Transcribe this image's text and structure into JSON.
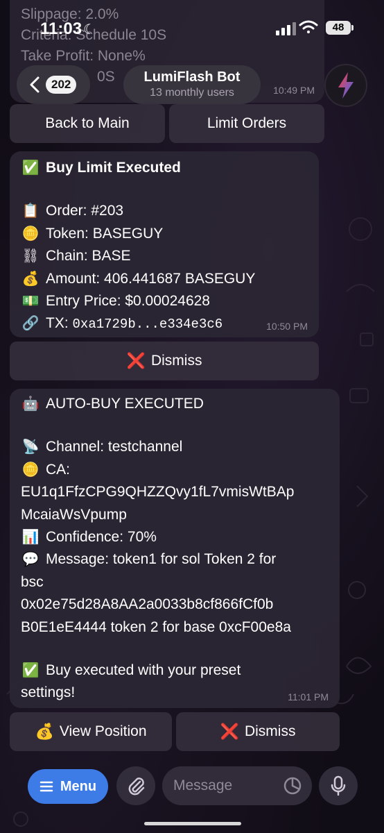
{
  "status_bar": {
    "time": "11:03",
    "battery": "48"
  },
  "previous_message": {
    "lines": [
      "Slippage: 2.0%",
      "Criteria: Schedule 10S",
      "Take Profit: None%",
      "0S"
    ],
    "time": "10:49 PM"
  },
  "header": {
    "back_count": "202",
    "title": "LumiFlash Bot",
    "subtitle": "13 monthly users"
  },
  "keyboard_top": {
    "back_to_main": "Back to Main",
    "limit_orders": "Limit Orders"
  },
  "limit_message": {
    "title_emoji": "✅",
    "title": "Buy Limit Executed",
    "rows": [
      {
        "emoji": "📋",
        "label": "Order: #203"
      },
      {
        "emoji": "🪙",
        "label": "Token: BASEGUY"
      },
      {
        "emoji": "⛓",
        "label": "Chain: BASE"
      },
      {
        "emoji": "💰",
        "label": "Amount: 406.441687 BASEGUY"
      },
      {
        "emoji": "💵",
        "label": "Entry Price: $0.00024628"
      }
    ],
    "tx_emoji": "🔗",
    "tx_label": "TX: ",
    "tx_value": "0xa1729b...e334e3c6",
    "time": "10:50 PM"
  },
  "dismiss_1": {
    "emoji": "❌",
    "label": "Dismiss"
  },
  "autobuy_message": {
    "title_emoji": "🤖",
    "title": "AUTO-BUY EXECUTED",
    "channel_emoji": "📡",
    "channel": "Channel: testchannel",
    "ca_emoji": "🪙",
    "ca_label": "CA:",
    "ca_line1": "EU1q1FfzCPG9QHZZQvy1fL7vmisWtBAp",
    "ca_line2": "McaiaWsVpump",
    "confidence_emoji": "📊",
    "confidence": "Confidence: 70%",
    "message_emoji": "💬",
    "message_line1": "Message: token1 for sol Token 2 for",
    "message_line2": "bsc",
    "message_line3": "0x02e75d28A8AA2a0033b8cf866fCf0b",
    "message_line4": "B0E1eE4444 token 2 for base 0xcF00e8a",
    "footer_emoji": "✅",
    "footer_line1": "Buy executed with your preset",
    "footer_line2": "settings!",
    "time": "11:01 PM"
  },
  "keyboard_bottom": {
    "view_emoji": "💰",
    "view_position": "View Position",
    "dismiss_emoji": "❌",
    "dismiss": "Dismiss"
  },
  "input_bar": {
    "menu_label": "Menu",
    "placeholder": "Message"
  },
  "colors": {
    "accent": "#3d7be6",
    "bubble": "#2c2634",
    "background": "#110d16"
  }
}
